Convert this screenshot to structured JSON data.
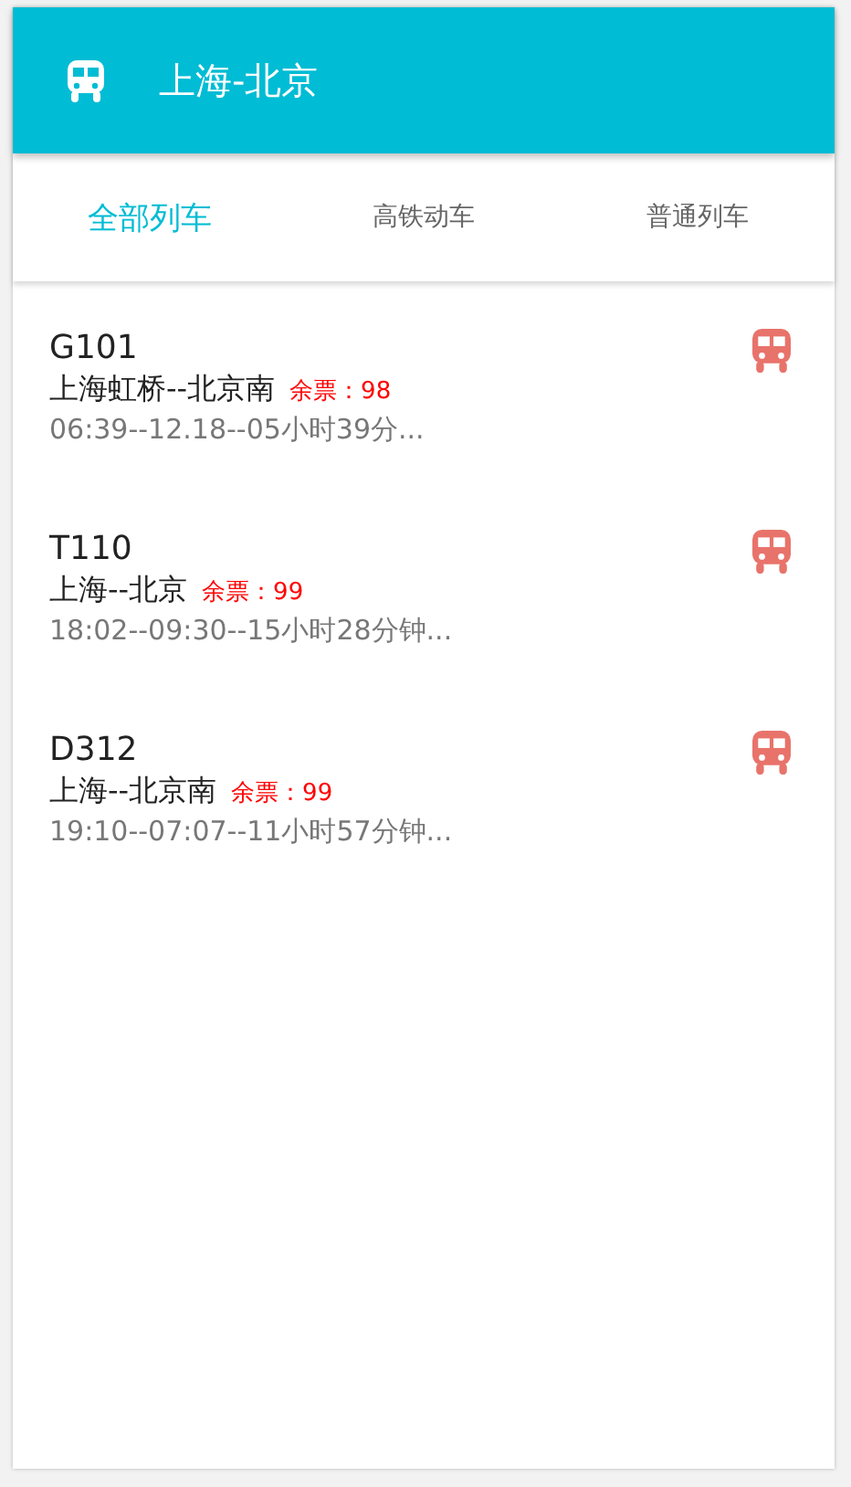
{
  "header": {
    "title": "上海-北京"
  },
  "tabs": [
    {
      "label": "全部列车",
      "selected": true
    },
    {
      "label": "高铁动车",
      "selected": false
    },
    {
      "label": "普通列车",
      "selected": false
    }
  ],
  "trains": [
    {
      "number": "G101",
      "route": "上海虹桥--北京南",
      "tickets": "余票：98",
      "times": "06:39--12.18--05小时39分..."
    },
    {
      "number": "T110",
      "route": "上海--北京",
      "tickets": "余票：99",
      "times": "18:02--09:30--15小时28分钟..."
    },
    {
      "number": "D312",
      "route": "上海--北京南",
      "tickets": "余票：99",
      "times": "19:10--07:07--11小时57分钟..."
    }
  ]
}
